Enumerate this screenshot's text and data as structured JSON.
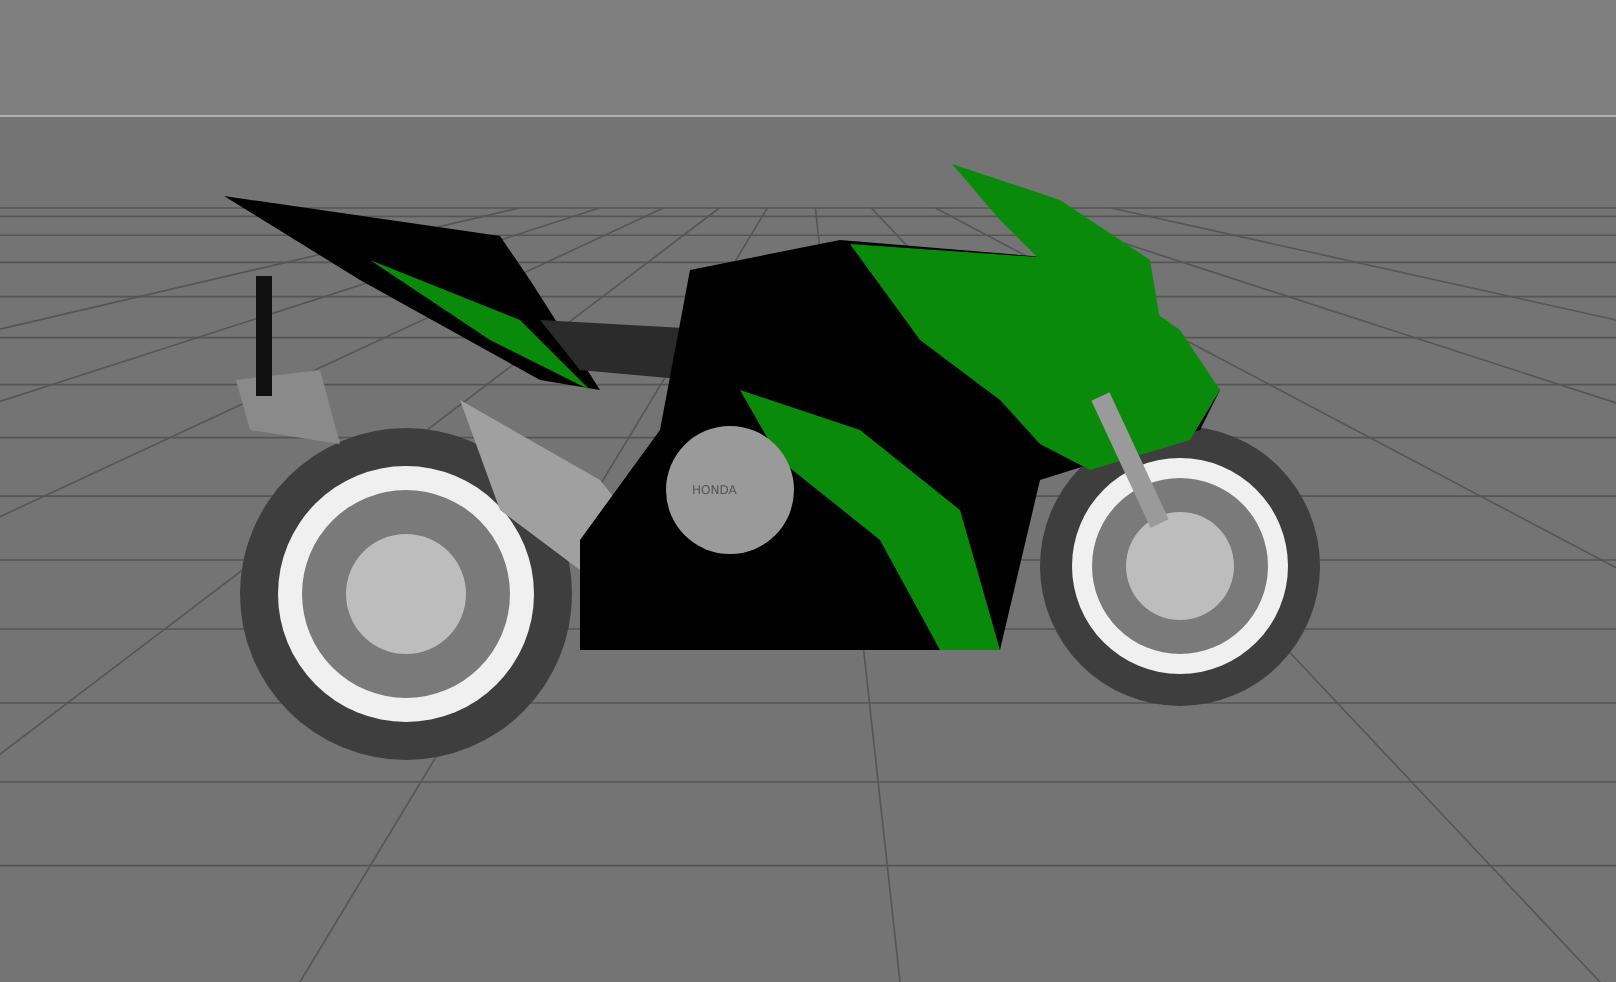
{
  "viewport": {
    "kind": "perspective-grid",
    "engine_label": "HONDA"
  }
}
